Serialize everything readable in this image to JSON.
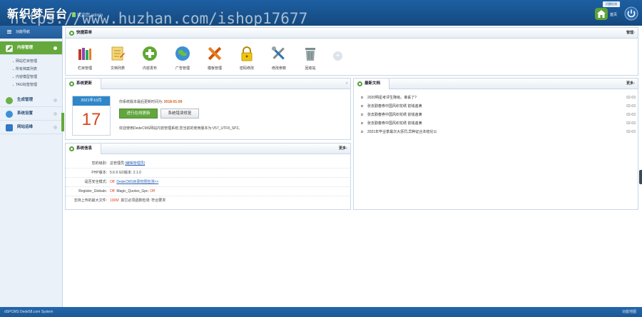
{
  "header": {
    "logo": "新织梦后台",
    "welcome": "欢迎您,admin",
    "watermark": "https://www.huzhan.com/ishop17677",
    "top_tip": "问题检测",
    "home_label": "首页"
  },
  "sidebar": {
    "title": "功能导航",
    "groups": [
      {
        "label": "内容管理",
        "active": true
      },
      {
        "label": "生成管理",
        "active": false
      },
      {
        "label": "系统设置",
        "active": false
      },
      {
        "label": "网站运维",
        "active": false
      }
    ],
    "content_items": [
      "网站栏目管理",
      "所有档案列表",
      "内容模型管理",
      "TAG标签管理"
    ]
  },
  "quick_menu": {
    "title": "快捷菜单",
    "manage": "管理",
    "items": [
      {
        "label": "栏目管理",
        "icon": "books-icon"
      },
      {
        "label": "文档列表",
        "icon": "notepad-icon"
      },
      {
        "label": "内容发布",
        "icon": "add-icon"
      },
      {
        "label": "广告管理",
        "icon": "globe-icon"
      },
      {
        "label": "模板管理",
        "icon": "tools-cross-icon"
      },
      {
        "label": "密码修改",
        "icon": "lock-icon"
      },
      {
        "label": "修改参数",
        "icon": "wrench-icon"
      },
      {
        "label": "回收站",
        "icon": "trash-icon"
      }
    ]
  },
  "system_update": {
    "title": "系统更新",
    "cal_month": "2021年10月",
    "cal_day": "17",
    "last_update_label": "你系统版本最后更新时间为:",
    "last_update_date": "2018-01-09",
    "online_update_btn": "进行在线更新",
    "repair_btn": "系统错误修复",
    "version_text": "欢迎使用DedeCMS网站内容管理系统,您当前的使用版本为:V57_UTF8_SP2。"
  },
  "latest_docs": {
    "title": "最新文档",
    "more": "更多",
    "rows": [
      {
        "title": "2020明星考评生降级。谁丢了?",
        "date": "02-03"
      },
      {
        "title": "张去勤春券中国风织花绣 前钱遍满",
        "date": "02-03"
      },
      {
        "title": "张去勤春券中国风织花绣 前钱遍满",
        "date": "02-03"
      },
      {
        "title": "张去勤春券中国风织花绣 前钱遍满",
        "date": "02-03"
      },
      {
        "title": "2021年毕业季最次大惩罚,异种证合本结论公",
        "date": "02-03"
      }
    ]
  },
  "system_info": {
    "title": "系统信息",
    "more": "更多",
    "rows": [
      {
        "key": "您的级别:",
        "value": "总管理员",
        "extra": "[编辑管理员]"
      },
      {
        "key": "PHP版本:",
        "value": "5.6.9   GD版本:",
        "extra": "2.1.0"
      },
      {
        "key": "是否安全模式:",
        "value": "Off",
        "extra": "DedeCMS目录权限检测>>"
      },
      {
        "key": "Register_Globals:",
        "value": "Off",
        "value2": "Magic_Quotes_Gpc:",
        "value3": "Off"
      },
      {
        "key": "支持上传的最大文件:",
        "value": "100M",
        "extra": "其它必须函数检测:",
        "extra2": "符合要求"
      }
    ]
  },
  "footer": {
    "left": "dSPCMS  Dede58.com System",
    "right": "功能地图"
  },
  "colors": {
    "header_blue": "#1d5fa3",
    "accent_green": "#65a93d",
    "highlight_red": "#e0401b"
  }
}
